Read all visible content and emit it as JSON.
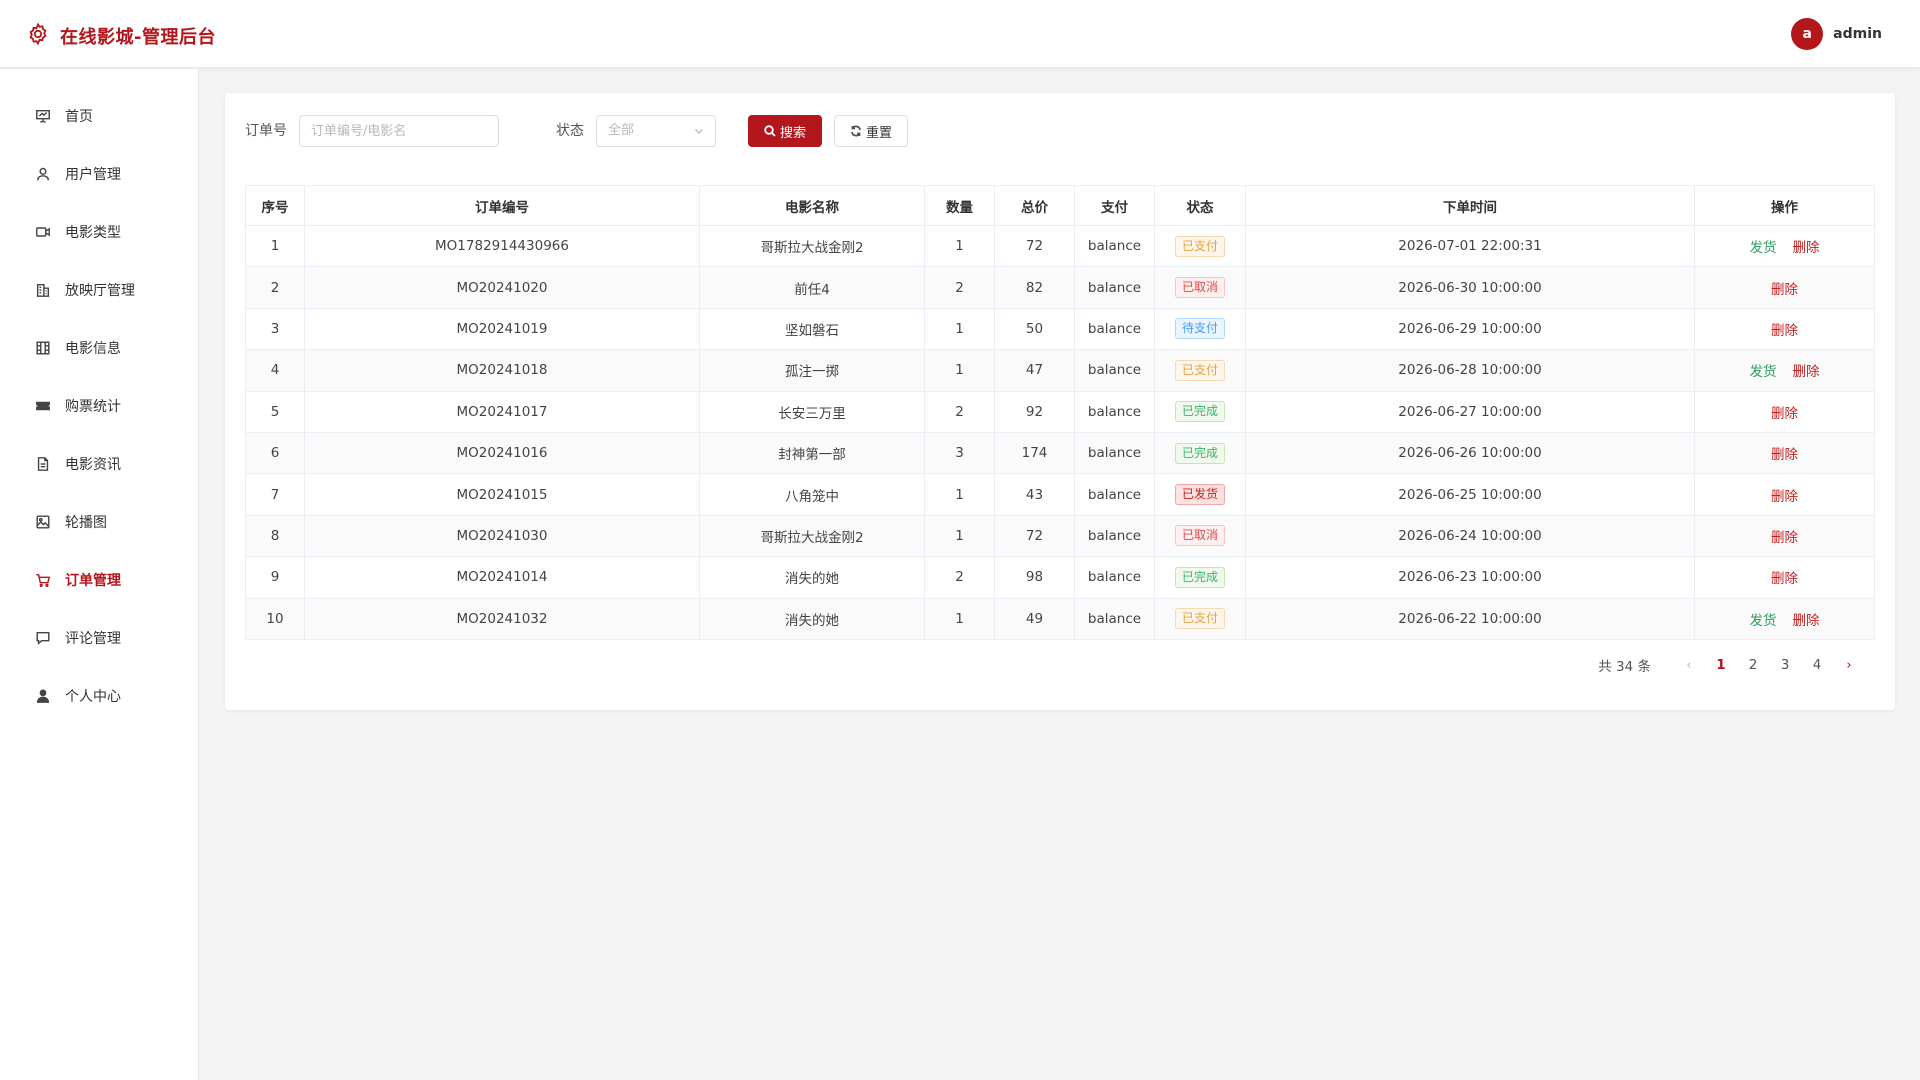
{
  "app": {
    "title": "在线影城-管理后台",
    "username": "admin",
    "avatar_letter": "a",
    "accent_color": "#b3161b"
  },
  "sidebar": {
    "items": [
      {
        "label": "首页",
        "icon": "presentation-icon",
        "active": false
      },
      {
        "label": "用户管理",
        "icon": "user-icon",
        "active": false
      },
      {
        "label": "电影类型",
        "icon": "video-camera-icon",
        "active": false
      },
      {
        "label": "放映厅管理",
        "icon": "building-icon",
        "active": false
      },
      {
        "label": "电影信息",
        "icon": "film-grid-icon",
        "active": false
      },
      {
        "label": "购票统计",
        "icon": "ticket-icon",
        "active": false
      },
      {
        "label": "电影资讯",
        "icon": "document-icon",
        "active": false
      },
      {
        "label": "轮播图",
        "icon": "image-icon",
        "active": false
      },
      {
        "label": "订单管理",
        "icon": "cart-icon",
        "active": true
      },
      {
        "label": "评论管理",
        "icon": "comment-icon",
        "active": false
      },
      {
        "label": "个人中心",
        "icon": "person-icon",
        "active": false
      }
    ]
  },
  "filter": {
    "order_label": "订单号",
    "order_placeholder": "订单编号/电影名",
    "status_label": "状态",
    "status_value": "全部",
    "search_label": "搜索",
    "reset_label": "重置"
  },
  "table": {
    "headers": [
      "序号",
      "订单编号",
      "电影名称",
      "数量",
      "总价",
      "支付",
      "状态",
      "下单时间",
      "操作"
    ],
    "ship_label": "发货",
    "delete_label": "删除",
    "rows": [
      {
        "idx": "1",
        "order_no": "MO1782914430966",
        "movie": "哥斯拉大战金刚2",
        "qty": "1",
        "total": "72",
        "pay": "balance",
        "status": "已支付",
        "status_type": "paid",
        "time": "2026-07-01 22:00:31",
        "can_ship": true
      },
      {
        "idx": "2",
        "order_no": "MO20241020",
        "movie": "前任4",
        "qty": "2",
        "total": "82",
        "pay": "balance",
        "status": "已取消",
        "status_type": "cancel",
        "time": "2026-06-30 10:00:00",
        "can_ship": false
      },
      {
        "idx": "3",
        "order_no": "MO20241019",
        "movie": "坚如磐石",
        "qty": "1",
        "total": "50",
        "pay": "balance",
        "status": "待支付",
        "status_type": "pending",
        "time": "2026-06-29 10:00:00",
        "can_ship": false
      },
      {
        "idx": "4",
        "order_no": "MO20241018",
        "movie": "孤注一掷",
        "qty": "1",
        "total": "47",
        "pay": "balance",
        "status": "已支付",
        "status_type": "paid",
        "time": "2026-06-28 10:00:00",
        "can_ship": true
      },
      {
        "idx": "5",
        "order_no": "MO20241017",
        "movie": "长安三万里",
        "qty": "2",
        "total": "92",
        "pay": "balance",
        "status": "已完成",
        "status_type": "done",
        "time": "2026-06-27 10:00:00",
        "can_ship": false
      },
      {
        "idx": "6",
        "order_no": "MO20241016",
        "movie": "封神第一部",
        "qty": "3",
        "total": "174",
        "pay": "balance",
        "status": "已完成",
        "status_type": "done",
        "time": "2026-06-26 10:00:00",
        "can_ship": false
      },
      {
        "idx": "7",
        "order_no": "MO20241015",
        "movie": "八角笼中",
        "qty": "1",
        "total": "43",
        "pay": "balance",
        "status": "已发货",
        "status_type": "shipped",
        "time": "2026-06-25 10:00:00",
        "can_ship": false
      },
      {
        "idx": "8",
        "order_no": "MO20241030",
        "movie": "哥斯拉大战金刚2",
        "qty": "1",
        "total": "72",
        "pay": "balance",
        "status": "已取消",
        "status_type": "cancel",
        "time": "2026-06-24 10:00:00",
        "can_ship": false
      },
      {
        "idx": "9",
        "order_no": "MO20241014",
        "movie": "消失的她",
        "qty": "2",
        "total": "98",
        "pay": "balance",
        "status": "已完成",
        "status_type": "done",
        "time": "2026-06-23 10:00:00",
        "can_ship": false
      },
      {
        "idx": "10",
        "order_no": "MO20241032",
        "movie": "消失的她",
        "qty": "1",
        "total": "49",
        "pay": "balance",
        "status": "已支付",
        "status_type": "paid",
        "time": "2026-06-22 10:00:00",
        "can_ship": true
      }
    ]
  },
  "pagination": {
    "total_text": "共 34 条",
    "pages": [
      "1",
      "2",
      "3",
      "4"
    ],
    "current": "1",
    "prev_icon": "chevron-left-icon",
    "next_icon": "chevron-right-icon"
  }
}
